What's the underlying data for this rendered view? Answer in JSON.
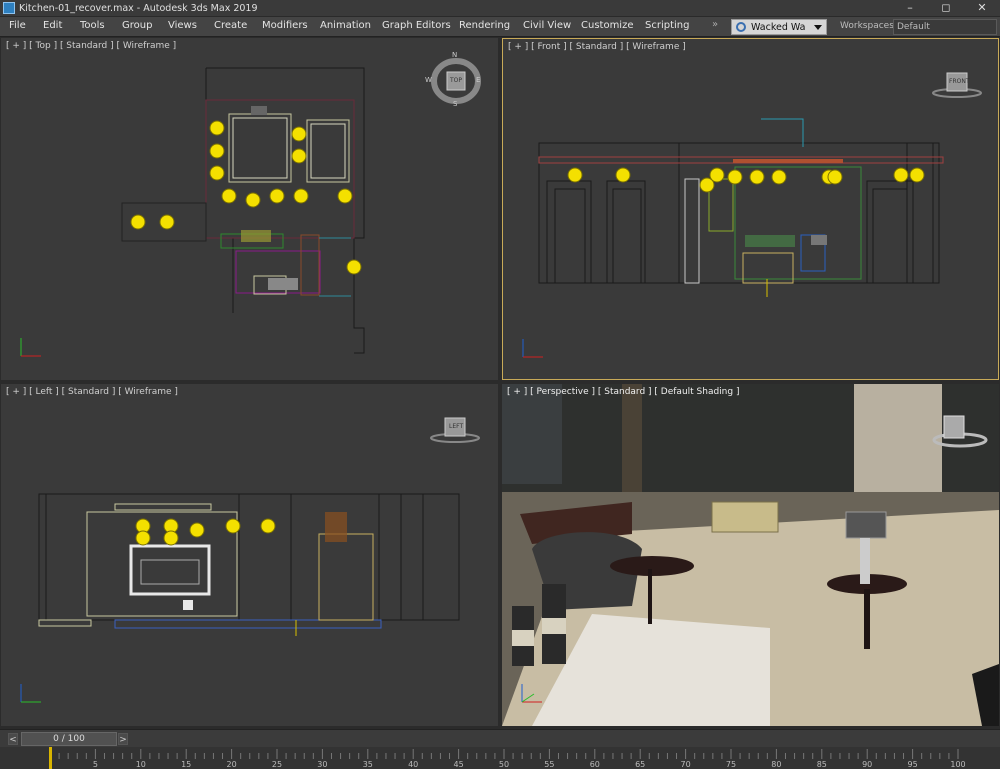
{
  "window": {
    "title": "Kitchen-01_recover.max - Autodesk 3ds Max 2019",
    "minimize": "–",
    "maximize": "◻",
    "close": "✕"
  },
  "menu": {
    "items": [
      "File",
      "Edit",
      "Tools",
      "Group",
      "Views",
      "Create",
      "Modifiers",
      "Animation",
      "Graph Editors",
      "Rendering",
      "Civil View",
      "Customize",
      "Scripting"
    ]
  },
  "user": {
    "name": "Wacked Wa",
    "icon": "user-icon"
  },
  "workspaces": {
    "label": "Workspaces:",
    "value": "Default"
  },
  "viewports": {
    "top": {
      "label": "[ + ] [ Top ] [ Standard ] [ Wireframe ]"
    },
    "front": {
      "label": "[ + ] [ Front ] [ Standard ] [ Wireframe ]"
    },
    "left": {
      "label": "[ + ] [ Left ] [ Standard ] [ Wireframe ]"
    },
    "perspective": {
      "label": "[ + ] [ Perspective ] [ Standard ] [ Default Shading ]"
    }
  },
  "viewcube": {
    "top_face": "TOP",
    "front_face": "FRONT",
    "left_face": "LEFT",
    "compass": {
      "n": "N",
      "s": "S",
      "e": "E",
      "w": "W"
    }
  },
  "timeline": {
    "frame_display": "0 / 100",
    "prev": "<",
    "next": ">",
    "ticks": [
      "0",
      "5",
      "10",
      "15",
      "20",
      "25",
      "30",
      "35",
      "40",
      "45",
      "50",
      "55",
      "60",
      "65",
      "70",
      "75",
      "80",
      "85",
      "90",
      "95",
      "100"
    ]
  },
  "colors": {
    "accent": "#c8aa58",
    "yellow_lamp": "#f4e000",
    "viewport_bg": "#3a3a3a"
  }
}
